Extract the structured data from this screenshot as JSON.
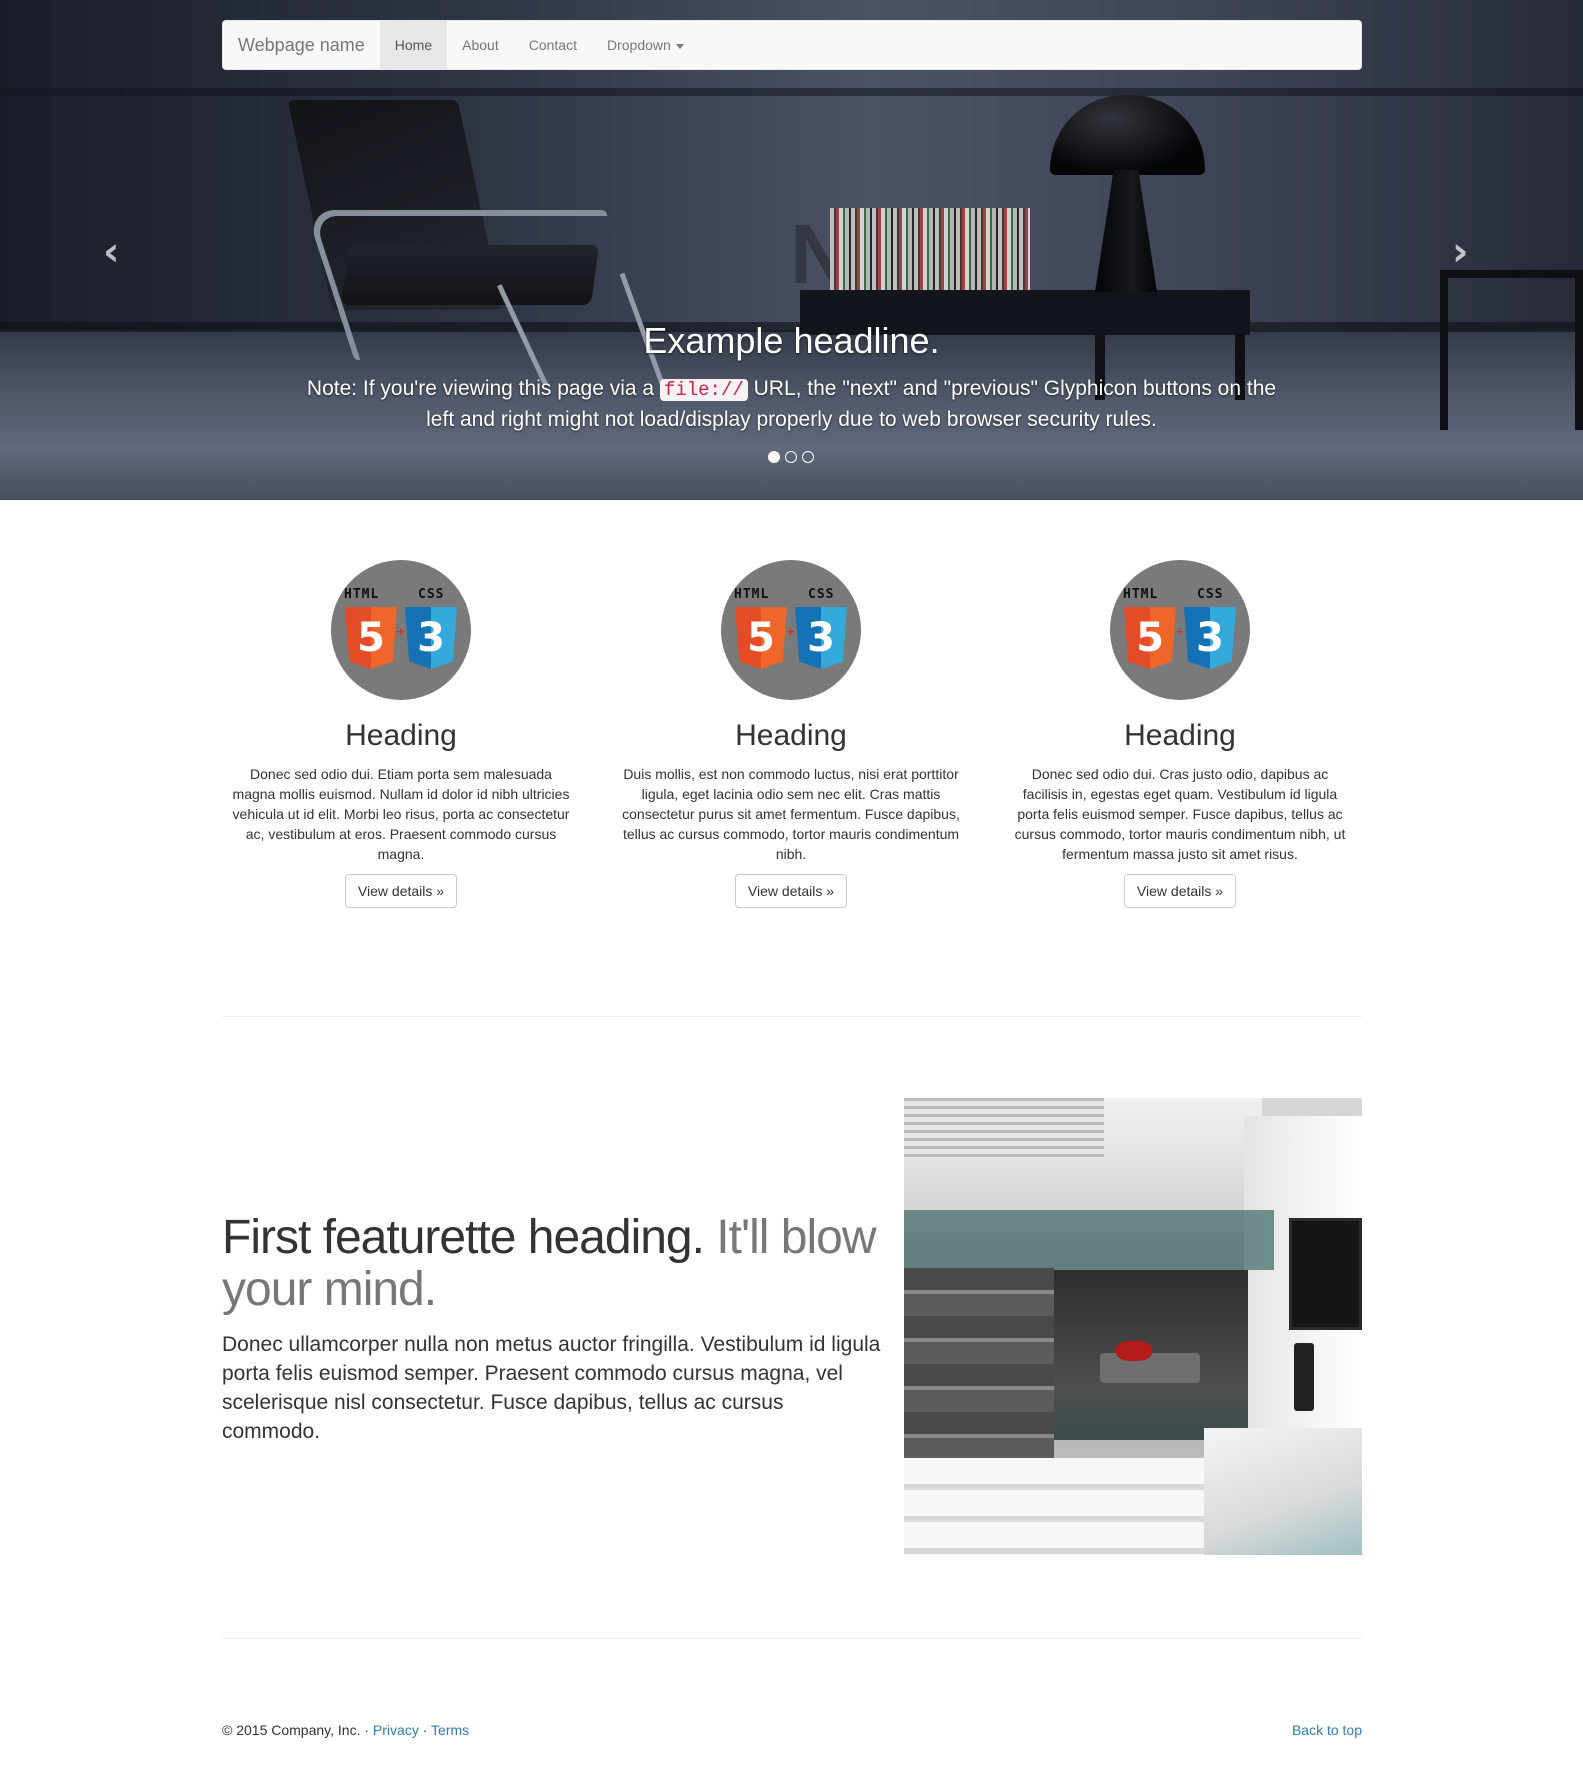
{
  "navbar": {
    "brand": "Webpage name",
    "items": [
      {
        "label": "Home",
        "active": true
      },
      {
        "label": "About"
      },
      {
        "label": "Contact"
      },
      {
        "label": "Dropdown"
      }
    ]
  },
  "carousel": {
    "prev_icon": "chevron-left-icon",
    "next_icon": "chevron-right-icon",
    "prev_glyph": "‹",
    "next_glyph": "›",
    "headline": "Example headline.",
    "note_before": "Note: If you're viewing this page via a ",
    "note_code": "file://",
    "note_after": " URL, the \"next\" and \"previous\" Glyphicon buttons on the left and right might not load/display properly due to web browser security rules.",
    "indicators": [
      true,
      false,
      false
    ]
  },
  "columns": [
    {
      "badge_html": "HTML",
      "badge_css": "CSS",
      "badge_html_num": "5",
      "badge_css_num": "3",
      "heading": "Heading",
      "text": "Donec sed odio dui. Etiam porta sem malesuada magna mollis euismod. Nullam id dolor id nibh ultricies vehicula ut id elit. Morbi leo risus, porta ac consectetur ac, vestibulum at eros. Praesent commodo cursus magna.",
      "button": "View details »"
    },
    {
      "badge_html": "HTML",
      "badge_css": "CSS",
      "badge_html_num": "5",
      "badge_css_num": "3",
      "heading": "Heading",
      "text": "Duis mollis, est non commodo luctus, nisi erat porttitor ligula, eget lacinia odio sem nec elit. Cras mattis consectetur purus sit amet fermentum. Fusce dapibus, tellus ac cursus commodo, tortor mauris condimentum nibh.",
      "button": "View details »"
    },
    {
      "badge_html": "HTML",
      "badge_css": "CSS",
      "badge_html_num": "5",
      "badge_css_num": "3",
      "heading": "Heading",
      "text": "Donec sed odio dui. Cras justo odio, dapibus ac facilisis in, egestas eget quam. Vestibulum id ligula porta felis euismod semper. Fusce dapibus, tellus ac cursus commodo, tortor mauris condimentum nibh, ut fermentum massa justo sit amet risus.",
      "button": "View details »"
    }
  ],
  "featurette": {
    "heading": "First featurette heading.",
    "heading_muted": "It'll blow your mind.",
    "text": "Donec ullamcorper nulla non metus auctor fringilla. Vestibulum id ligula porta felis euismod semper. Praesent commodo cursus magna, vel scelerisque nisl consectetur. Fusce dapibus, tellus ac cursus commodo."
  },
  "footer": {
    "copyright": "© 2015 Company, Inc.",
    "sep": " · ",
    "privacy": "Privacy",
    "terms": "Terms",
    "back_to_top": "Back to top"
  },
  "colors": {
    "link": "#337ab7",
    "navbar_bg": "#f8f8f8",
    "html5": "#e34c26",
    "css3": "#1572b6"
  }
}
